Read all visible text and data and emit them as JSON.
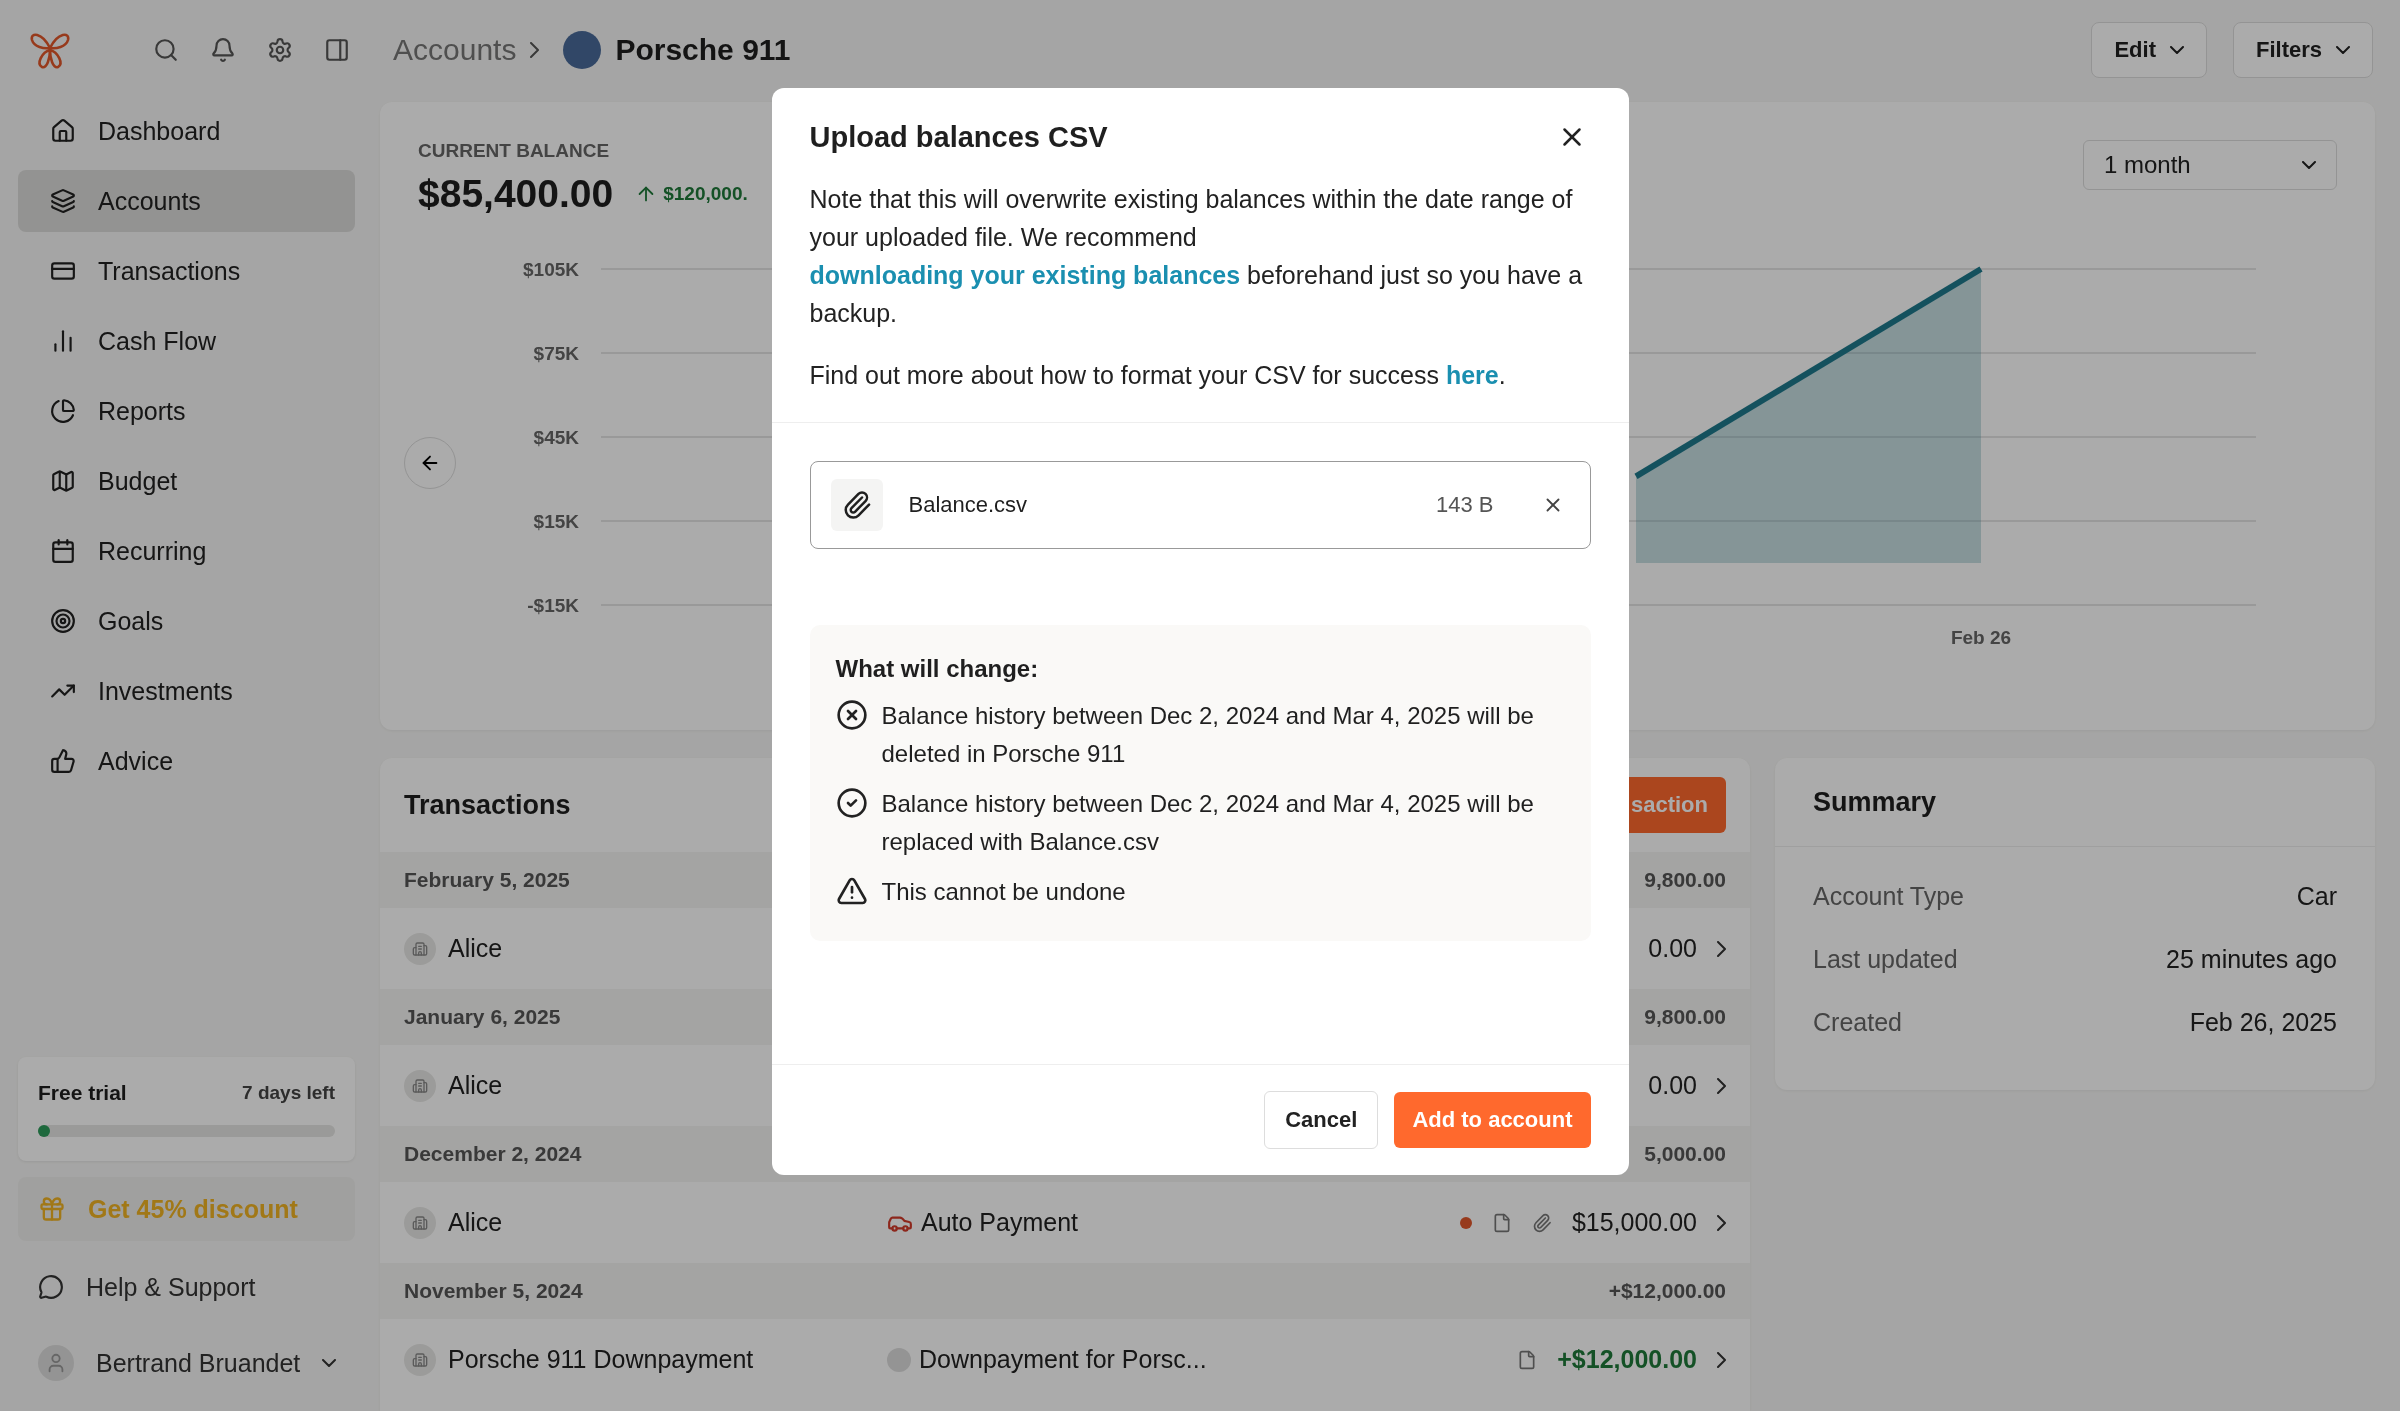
{
  "breadcrumb": {
    "parent": "Accounts",
    "current": "Porsche 911"
  },
  "header_buttons": [
    {
      "label": "Edit"
    },
    {
      "label": "Filters"
    }
  ],
  "sidebar": {
    "items": [
      {
        "label": "Dashboard",
        "selected": false
      },
      {
        "label": "Accounts",
        "selected": true
      },
      {
        "label": "Transactions",
        "selected": false
      },
      {
        "label": "Cash Flow",
        "selected": false
      },
      {
        "label": "Reports",
        "selected": false
      },
      {
        "label": "Budget",
        "selected": false
      },
      {
        "label": "Recurring",
        "selected": false
      },
      {
        "label": "Goals",
        "selected": false
      },
      {
        "label": "Investments",
        "selected": false
      },
      {
        "label": "Advice",
        "selected": false
      }
    ],
    "trial": {
      "title": "Free trial",
      "remaining": "7 days left",
      "level": 0.02
    },
    "promo": "Get 45% discount",
    "help": "Help & Support",
    "user": "Bertrand Bruandet"
  },
  "balance_card": {
    "label": "CURRENT BALANCE",
    "amount": "$85,400.00",
    "change": "$120,000.",
    "range": "1 month",
    "chart": {
      "y_labels": [
        "$105K",
        "$75K",
        "$45K",
        "$15K",
        "-$15K"
      ],
      "x_labels": [
        "Feb 26"
      ]
    }
  },
  "transactions": {
    "title": "Transactions",
    "button": "saction",
    "groups": [
      {
        "date": "February 5, 2025",
        "total": "9,800.00",
        "rows": [
          {
            "merchant": "Alice",
            "amount": "0.00",
            "income": false
          }
        ]
      },
      {
        "date": "January 6, 2025",
        "total": "9,800.00",
        "rows": [
          {
            "merchant": "Alice",
            "amount": "0.00",
            "income": false
          }
        ]
      },
      {
        "date": "December 2, 2024",
        "total": "5,000.00",
        "rows": [
          {
            "merchant": "Alice",
            "kind": "car",
            "category": "Auto Payment",
            "unreviewed": true,
            "note": true,
            "attachment": true,
            "amount": "$15,000.00",
            "income": false
          }
        ]
      },
      {
        "date": "November 5, 2024",
        "total": "+$12,000.00",
        "rows": [
          {
            "merchant": "Porsche 911 Downpayment",
            "kind": "dot",
            "category": "Downpayment for Porsc...",
            "unreviewed": false,
            "note": true,
            "attachment": false,
            "amount": "+$12,000.00",
            "income": true
          }
        ]
      }
    ]
  },
  "summary": {
    "title": "Summary",
    "rows": [
      {
        "label": "Account Type",
        "value": "Car"
      },
      {
        "label": "Last updated",
        "value": "25 minutes ago"
      },
      {
        "label": "Created",
        "value": "Feb 26, 2025"
      }
    ]
  },
  "modal": {
    "title": "Upload balances CSV",
    "paragraphs": [
      {
        "before": "Note that this will overwrite existing balances within the date range of your uploaded file. We recommend ",
        "link": "downloading your existing balances",
        "after": " beforehand just so you have a backup."
      },
      {
        "before": "Find out more about how to format your CSV for success ",
        "link": "here",
        "after": "."
      }
    ],
    "file": {
      "name": "Balance.csv",
      "size": "143 B"
    },
    "changes": {
      "title": "What will change:",
      "items": [
        {
          "kind": "delete",
          "text": "Balance history between Dec 2, 2024 and Mar 4, 2025 will be deleted in Porsche 911"
        },
        {
          "kind": "replace",
          "text": "Balance history between Dec 2, 2024 and Mar 4, 2025 will be replaced with Balance.csv"
        },
        {
          "kind": "warning",
          "text": "This cannot be undone"
        }
      ]
    },
    "cancel": "Cancel",
    "confirm": "Add to account"
  }
}
